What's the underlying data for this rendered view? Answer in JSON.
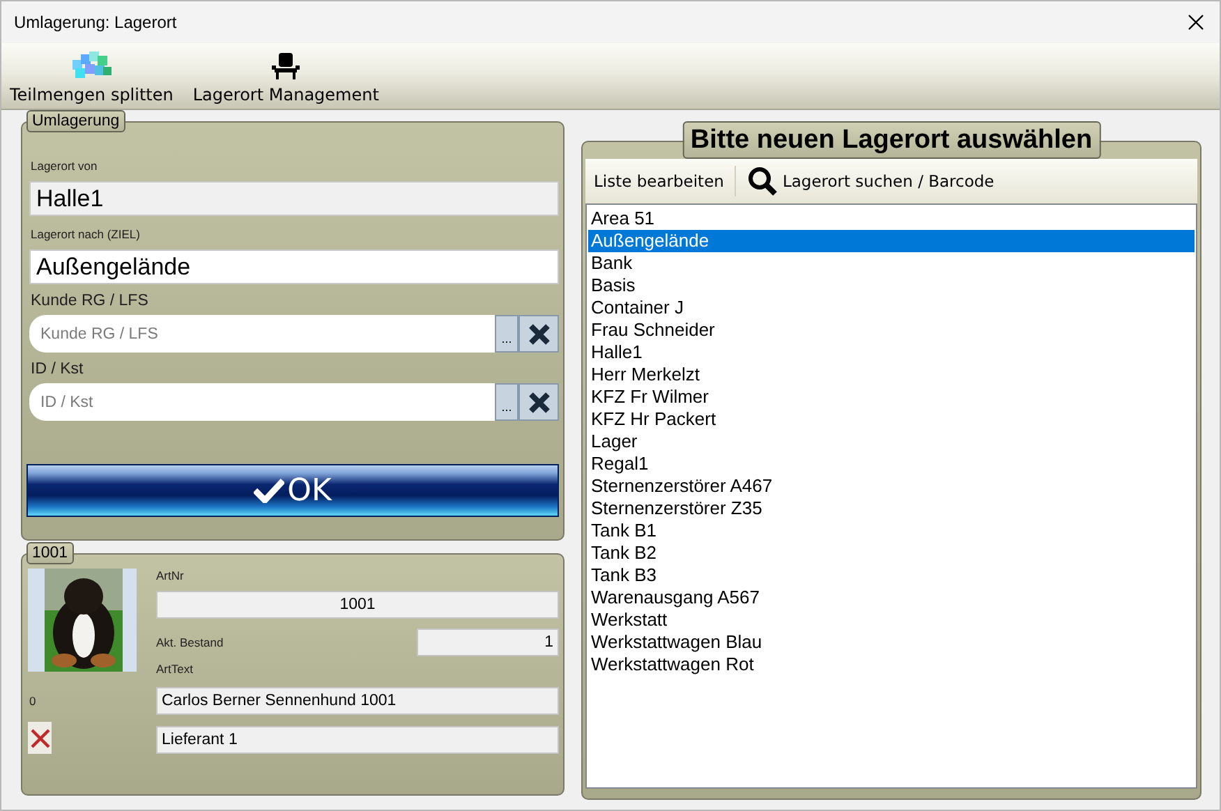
{
  "window": {
    "title": "Umlagerung: Lagerort"
  },
  "toolbar": [
    {
      "label": "Teilmengen splitten",
      "kind": "blocks"
    },
    {
      "label": "Lagerort Management",
      "kind": "chair"
    }
  ],
  "transfer": {
    "legend": "Umlagerung",
    "from": {
      "label": "Lagerort von",
      "value": "Halle1"
    },
    "to": {
      "label": "Lagerort nach (ZIEL)",
      "value": "Außengelände"
    },
    "lookups": [
      {
        "label": "Kunde RG / LFS",
        "placeholder": "Kunde RG / LFS",
        "browse": "..."
      },
      {
        "label": "ID / Kst",
        "placeholder": "ID / Kst",
        "browse": "..."
      }
    ],
    "ok_button": "OK"
  },
  "article": {
    "legend": "1001",
    "count": "0",
    "art_nr": {
      "label": "ArtNr",
      "value": "1001"
    },
    "stock": {
      "label": "Akt. Bestand",
      "value": "1"
    },
    "art_text": {
      "label": "ArtText",
      "value": "Carlos Berner Sennenhund 1001"
    },
    "supplier": {
      "value": "Lieferant 1"
    }
  },
  "locations": {
    "title": "Bitte neuen Lagerort auswählen",
    "edit_button": "Liste bearbeiten",
    "search_button": "Lagerort suchen / Barcode",
    "items": [
      {
        "label": "Area 51",
        "selected": false
      },
      {
        "label": "Außengelände",
        "selected": true
      },
      {
        "label": "Bank",
        "selected": false
      },
      {
        "label": "Basis",
        "selected": false
      },
      {
        "label": "Container J",
        "selected": false
      },
      {
        "label": "Frau Schneider",
        "selected": false
      },
      {
        "label": "Halle1",
        "selected": false
      },
      {
        "label": "Herr Merkelzt",
        "selected": false
      },
      {
        "label": "KFZ Fr Wilmer",
        "selected": false
      },
      {
        "label": "KFZ Hr Packert",
        "selected": false
      },
      {
        "label": "Lager",
        "selected": false
      },
      {
        "label": "Regal1",
        "selected": false
      },
      {
        "label": "Sternenzerstörer A467",
        "selected": false
      },
      {
        "label": "Sternenzerstörer Z35",
        "selected": false
      },
      {
        "label": "Tank B1",
        "selected": false
      },
      {
        "label": "Tank B2",
        "selected": false
      },
      {
        "label": "Tank B3",
        "selected": false
      },
      {
        "label": "Warenausgang A567",
        "selected": false
      },
      {
        "label": "Werkstatt",
        "selected": false
      },
      {
        "label": "Werkstattwagen Blau",
        "selected": false
      },
      {
        "label": "Werkstattwagen Rot",
        "selected": false
      }
    ]
  }
}
